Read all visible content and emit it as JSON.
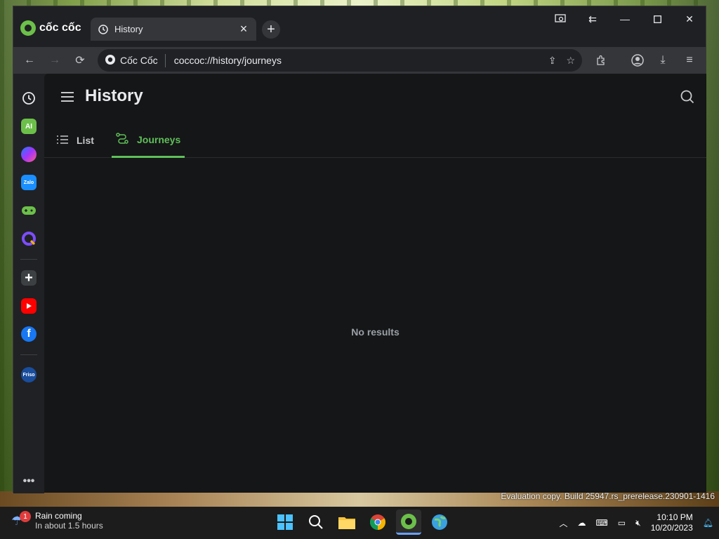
{
  "browser": {
    "brand": "cốc cốc",
    "tab_title": "History",
    "omnibox_site": "Cốc Cốc",
    "url": "coccoc://history/journeys"
  },
  "sidebar": {
    "ai_label": "AI",
    "zalo_label": "Zalo",
    "friso_label": "Friso"
  },
  "page": {
    "title": "History",
    "tabs": [
      {
        "label": "List"
      },
      {
        "label": "Journeys"
      }
    ],
    "empty_text": "No results"
  },
  "desktop": {
    "watermark_text": "Evaluation copy. Build 25947.rs_prerelease.230901-1416"
  },
  "taskbar": {
    "weather_title": "Rain coming",
    "weather_sub": "In about 1.5 hours",
    "weather_badge": "1",
    "time": "10:10 PM",
    "date": "10/20/2023"
  },
  "colors": {
    "accent": "#5fbf5a",
    "content_bg": "#151617",
    "toolbar_bg": "#35363a"
  }
}
